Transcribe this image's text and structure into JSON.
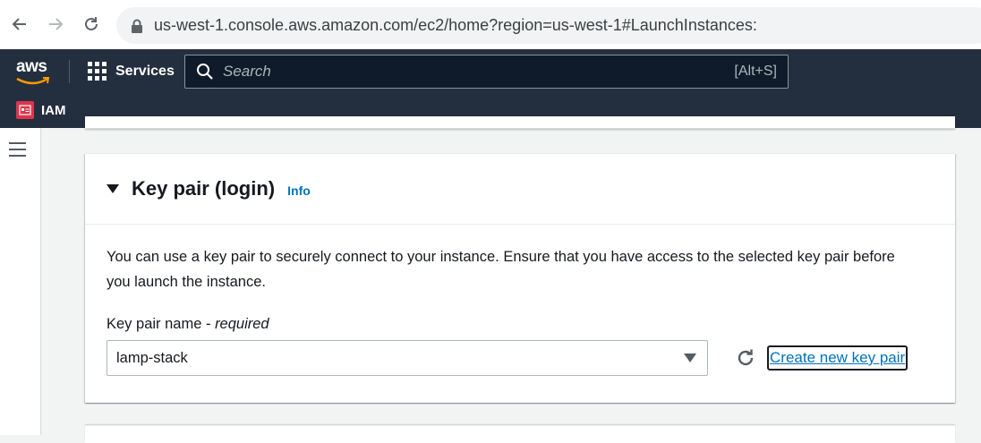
{
  "browser": {
    "url": "us-west-1.console.aws.amazon.com/ec2/home?region=us-west-1#LaunchInstances:"
  },
  "aws_nav": {
    "logo_text": "aws",
    "services_label": "Services",
    "search_placeholder": "Search",
    "search_shortcut": "[Alt+S]",
    "favorite_label": "IAM"
  },
  "key_pair": {
    "title": "Key pair (login)",
    "info_label": "Info",
    "description": "You can use a key pair to securely connect to your instance. Ensure that you have access to the selected key pair before you launch the instance.",
    "field_label": "Key pair name - ",
    "field_required": "required",
    "selected_value": "lamp-stack",
    "create_link": "Create new key pair"
  },
  "colors": {
    "aws_nav_bg": "#232f3e",
    "link": "#0073bb",
    "iam_badge": "#dd344c",
    "page_bg": "#f2f3f3"
  }
}
